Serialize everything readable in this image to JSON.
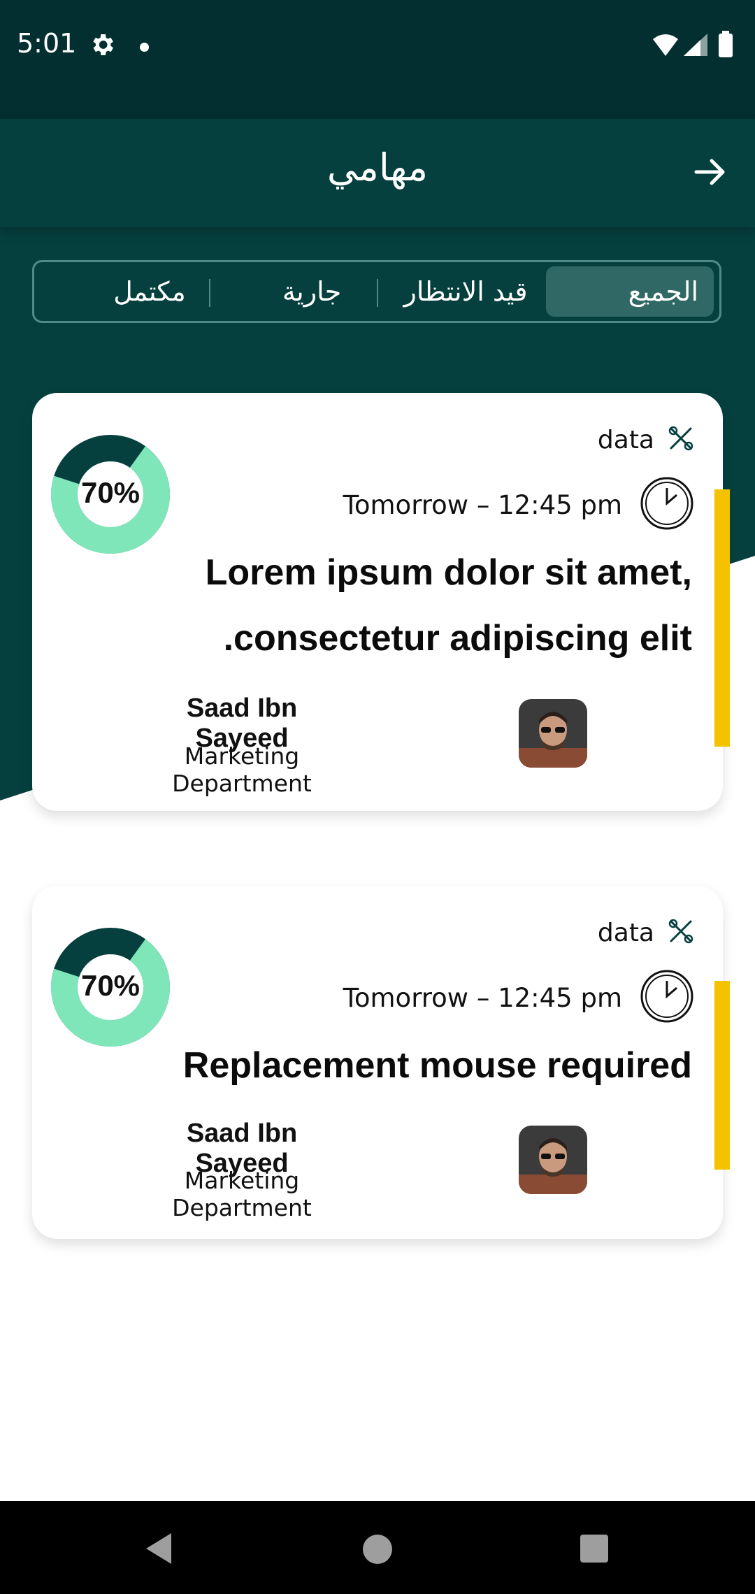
{
  "status_bar": {
    "time": "5:01"
  },
  "app_bar": {
    "title": "مهامي"
  },
  "tabs": [
    {
      "label": "الجميع",
      "selected": true
    },
    {
      "label": "قيد الانتظار",
      "selected": false
    },
    {
      "label": "جارية",
      "selected": false
    },
    {
      "label": "مكتمل",
      "selected": false
    }
  ],
  "tasks": [
    {
      "progress_label": "70%",
      "progress": 0.7,
      "tag": "data",
      "due": "Tomorrow – 12:45 pm",
      "title_line1": "Lorem ipsum dolor sit amet,",
      "title_line2": ".consectetur adipiscing elit",
      "assignee": "Saad Ibn Sayeed",
      "department": "Marketing Department"
    },
    {
      "progress_label": "70%",
      "progress": 0.7,
      "tag": "data",
      "due": "Tomorrow – 12:45 pm",
      "title_line1": "Replacement mouse required",
      "assignee": "Saad Ibn Sayeed",
      "department": "Marketing Department"
    }
  ],
  "colors": {
    "primary_dark": "#05403f",
    "progress_fill": "#7ee6b8",
    "progress_track": "#05403f",
    "accent_bar": "#f5c200"
  }
}
